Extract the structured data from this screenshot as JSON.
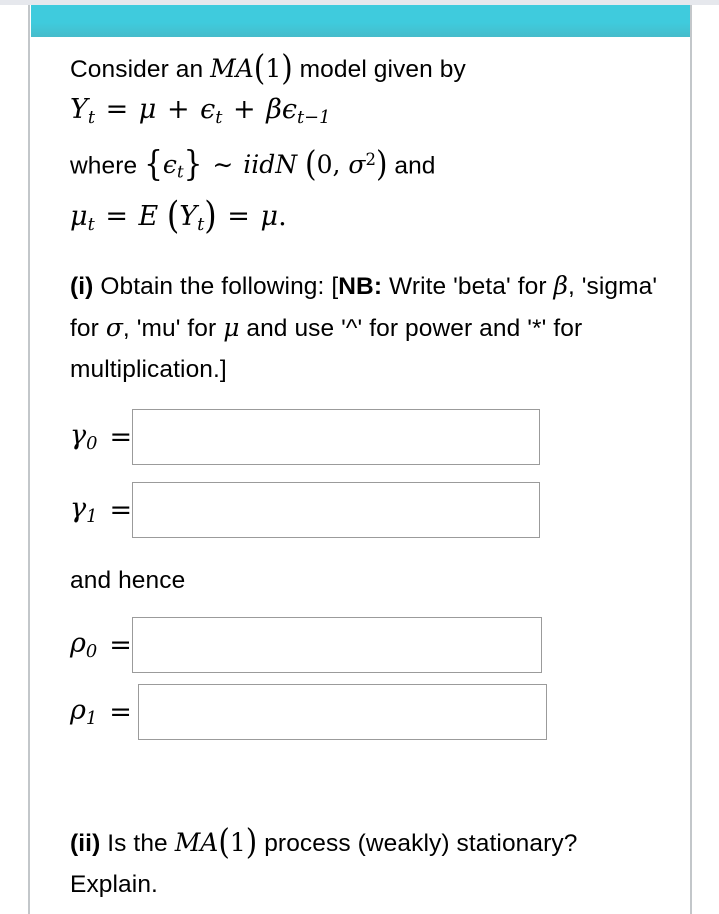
{
  "theme": {
    "header_color": "#3fcbdd",
    "header_color_bottom": "#46bccb",
    "frame_border_color": "#c3c7ca",
    "input_border_color": "#9b9b9b",
    "text_color": "#000000",
    "top_strip_color": "#e6e8ed"
  },
  "question": {
    "intro_line": "Consider an ",
    "intro_model": "MA(1)",
    "intro_tail": " model given by",
    "equation_model": "Y_t = mu + epsilon_t + beta*epsilon_{t-1}",
    "where_prefix": "where ",
    "where_body": "{epsilon_t} ~ iidN(0, sigma^2)",
    "where_tail": " and",
    "equation_mean": "mu_t = E(Y_t) = mu.",
    "part_i": {
      "marker": "(i)",
      "text_before_nb": " Obtain the following: [",
      "nb_label": "NB:",
      "nb_text_1": " Write 'beta' for ",
      "nb_sym_beta": "β",
      "nb_text_2": ", 'sigma' for ",
      "nb_sym_sigma": "σ",
      "nb_text_3": ", 'mu' for ",
      "nb_sym_mu": "μ",
      "nb_text_4": " and use '^' for power and '*' for multiplication.]"
    },
    "and_hence": "and hence",
    "part_ii": {
      "marker": "(ii)",
      "text_before_model": " Is the ",
      "model": "MA(1)",
      "text_after_model": " process (weakly) stationary? Explain."
    }
  },
  "answers": [
    {
      "id": "gamma0",
      "symbol": "γ",
      "subscript": "0",
      "equals": "=",
      "value": "",
      "placeholder": ""
    },
    {
      "id": "gamma1",
      "symbol": "γ",
      "subscript": "1",
      "equals": "=",
      "value": "",
      "placeholder": ""
    },
    {
      "id": "rho0",
      "symbol": "ρ",
      "subscript": "0",
      "equals": "=",
      "value": "",
      "placeholder": ""
    },
    {
      "id": "rho1",
      "symbol": "ρ",
      "subscript": "1",
      "equals": "=",
      "value": "",
      "placeholder": ""
    }
  ]
}
